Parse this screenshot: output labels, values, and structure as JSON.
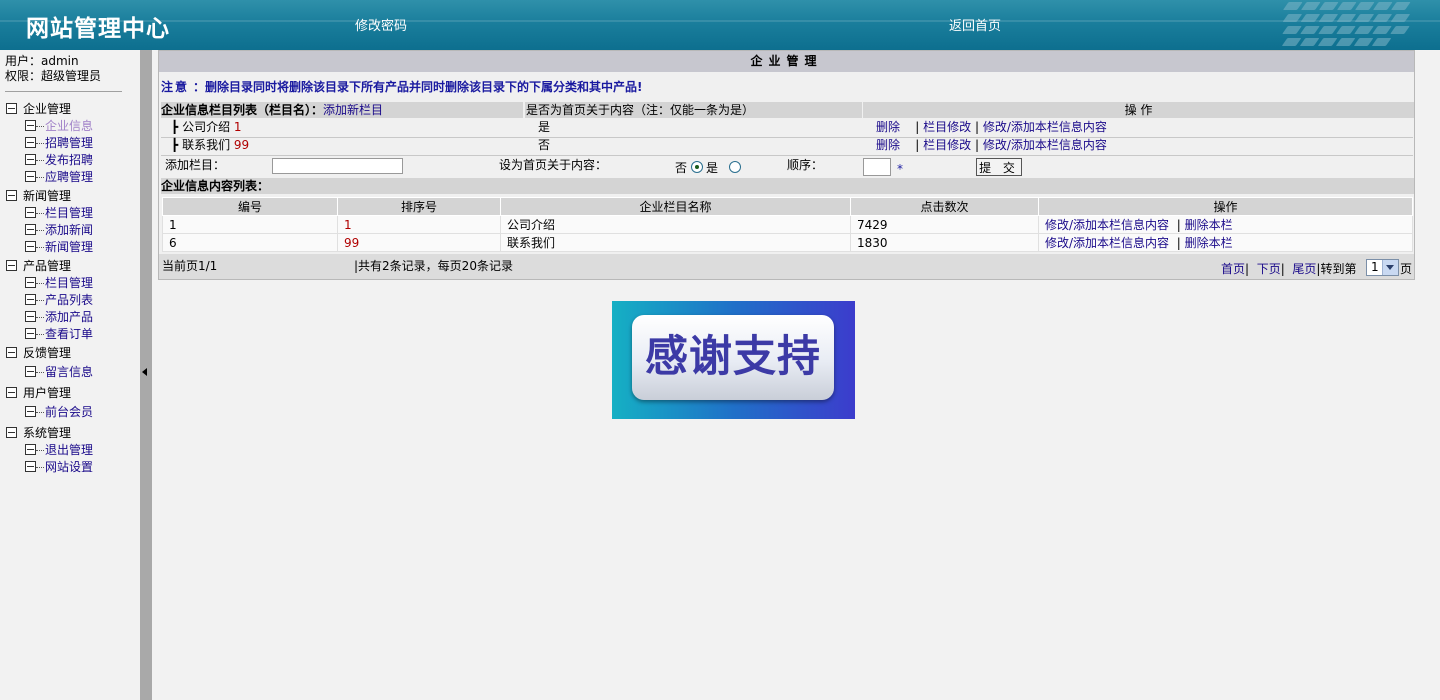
{
  "header": {
    "title": "网站管理中心",
    "change_password": "修改密码",
    "back_home": "返回首页"
  },
  "sidebar": {
    "user_label": "用户：admin",
    "role_label": "权限：超级管理员",
    "groups": [
      {
        "label": "企业管理",
        "items": [
          "企业信息",
          "招聘管理",
          "发布招聘",
          "应聘管理"
        ]
      },
      {
        "label": "新闻管理",
        "items": [
          "栏目管理",
          "添加新闻",
          "新闻管理"
        ]
      },
      {
        "label": "产品管理",
        "items": [
          "栏目管理",
          "产品列表",
          "添加产品",
          "查看订单"
        ]
      },
      {
        "label": "反馈管理",
        "items": [
          "留言信息"
        ]
      },
      {
        "label": "用户管理",
        "items": [
          "前台会员"
        ]
      },
      {
        "label": "系统管理",
        "items": [
          "退出管理",
          "网站设置"
        ]
      }
    ]
  },
  "panel": {
    "title": "企业管理",
    "notice_label": "注意",
    "notice_text": "：删除目录同时将删除该目录下所有产品并同时删除该目录下的下属分类和其中产品!",
    "list_header": "企业信息栏目列表（栏目名）：",
    "add_column_link": "添加新栏目",
    "homepage_header": "是否为首页关于内容（注：仅能一条为是）",
    "ops_header": "操 作",
    "columns": [
      {
        "name": "公司介绍",
        "order": "1",
        "is_home": "是"
      },
      {
        "name": "联系我们",
        "order": "99",
        "is_home": "否"
      }
    ],
    "op_delete": "删除",
    "op_edit_column": "栏目修改",
    "op_edit_content": "修改/添加本栏信息内容",
    "sep": "|",
    "add_form": {
      "add_label": "添加栏目：",
      "home_label": "设为首页关于内容：",
      "no": "否",
      "yes": "是",
      "order_label": "顺序：",
      "required": "*",
      "submit": "提 交"
    },
    "content_list_title": "企业信息内容列表：",
    "table": {
      "headers": [
        "编号",
        "排序号",
        "企业栏目名称",
        "点击数次",
        "操作"
      ],
      "rows": [
        {
          "id": "1",
          "order": "1",
          "name": "公司介绍",
          "clicks": "7429"
        },
        {
          "id": "6",
          "order": "99",
          "name": "联系我们",
          "clicks": "1830"
        }
      ],
      "op_edit": "修改/添加本栏信息内容",
      "op_delete": "删除本栏"
    },
    "pager": {
      "current": "当前页1/1",
      "summary": "|共有2条记录，每页20条记录",
      "first": "首页",
      "next": "下页",
      "last": "尾页",
      "goto": "|转到第",
      "page_value": "1",
      "page_suffix": "页"
    }
  },
  "banner": {
    "text": "感谢支持"
  },
  "colors": {
    "header": "#1a7e9c",
    "link": "#1a0a8a",
    "accent_red": "#b00000",
    "banner_text": "#3c3aa6"
  }
}
